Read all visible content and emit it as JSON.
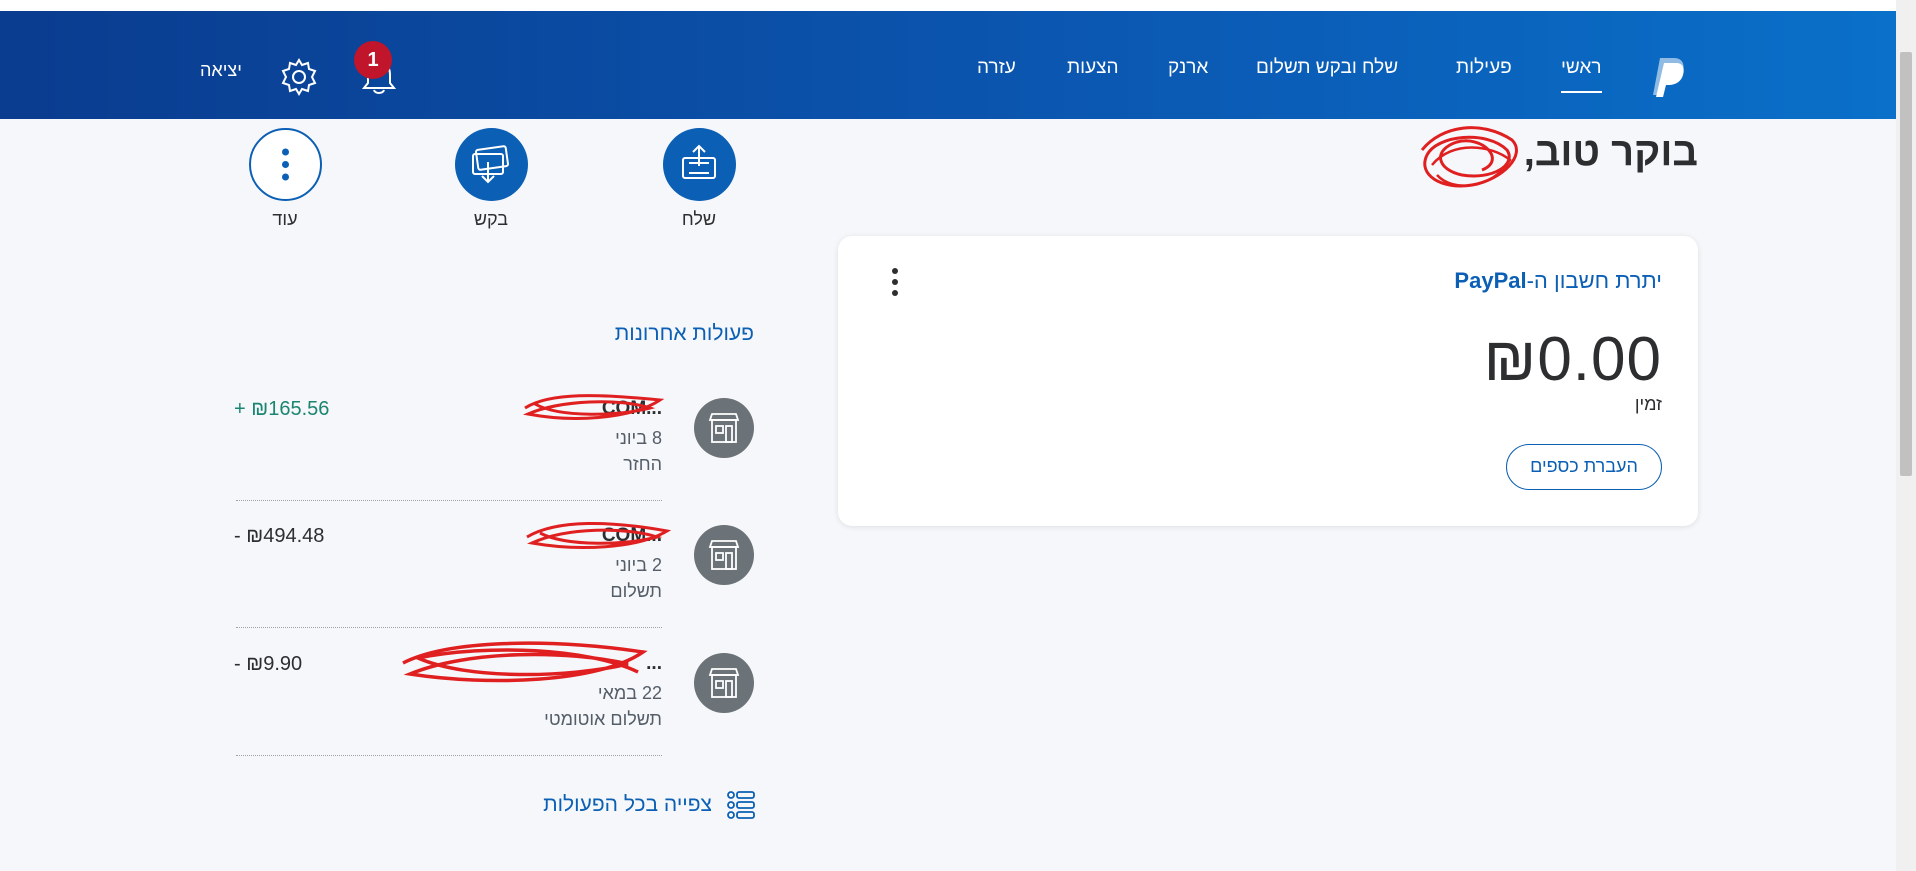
{
  "nav": {
    "items": [
      {
        "label": "ראשי",
        "active": true
      },
      {
        "label": "פעילות",
        "active": false
      },
      {
        "label": "שלח ובקש תשלום",
        "active": false
      },
      {
        "label": "ארנק",
        "active": false
      },
      {
        "label": "הצעות",
        "active": false
      },
      {
        "label": "עזרה",
        "active": false
      }
    ],
    "notification_count": "1",
    "logout_label": "יציאה"
  },
  "greeting": "בוקר טוב,",
  "balance": {
    "title_prefix": "יתרת חשבון ה-",
    "title_brand": "PayPal",
    "amount": "₪0.00",
    "label": "זמין",
    "transfer_label": "העברת כספים"
  },
  "actions": [
    {
      "label": "שלח",
      "icon": "send-money-icon"
    },
    {
      "label": "בקש",
      "icon": "request-money-icon"
    },
    {
      "label": "עוד",
      "icon": "more-vertical-icon"
    }
  ],
  "recent": {
    "title": "פעולות אחרונות",
    "transactions": [
      {
        "name": "...COM",
        "date": "8 ביוני",
        "type": "החזר",
        "amount": "+ ₪165.56",
        "direction": "pos"
      },
      {
        "name": "...COM",
        "date": "2 ביוני",
        "type": "תשלום",
        "amount": "- ₪494.48",
        "direction": "neg"
      },
      {
        "name": "...",
        "date": "22 במאי",
        "type": "תשלום אוטומטי",
        "amount": "- ₪9.90",
        "direction": "neg"
      }
    ],
    "view_all_label": "צפייה בכל הפעולות"
  },
  "colors": {
    "header_start": "#0a3c8f",
    "header_end": "#0a70c9",
    "link_blue": "#0b5fb4",
    "positive_green": "#1a8570",
    "badge_red": "#c0152b"
  }
}
